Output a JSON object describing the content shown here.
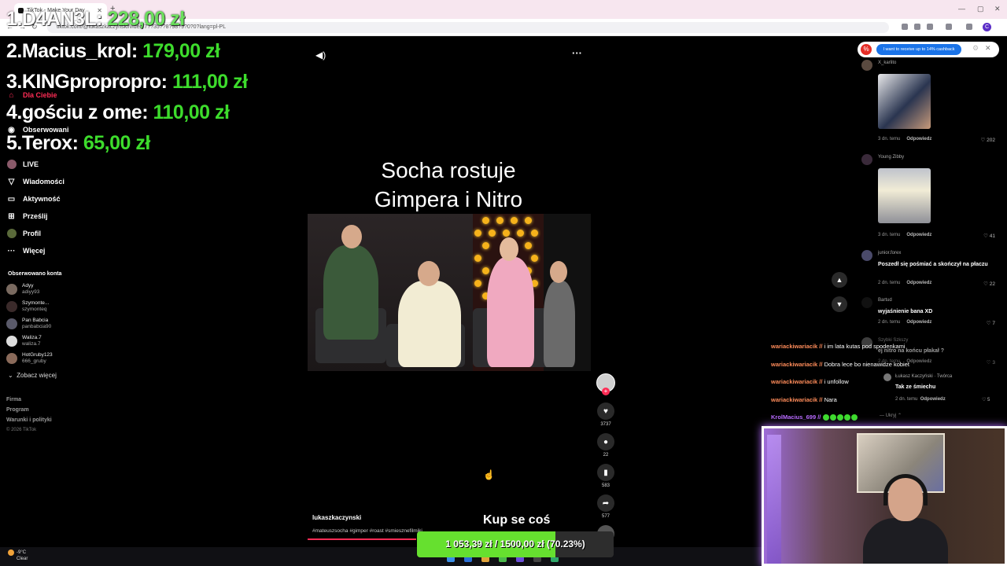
{
  "browser": {
    "tab_title": "TikTok - Make Your Day",
    "url": "tiktok.com/@lukaszkaczynski/video/7??35??8?98?9?0?0?lang=pl-PL",
    "profile_initial": "C"
  },
  "leaderboard": [
    {
      "rank_name": "1.D4AN3L:",
      "amount": "228,00 zł"
    },
    {
      "rank_name": "2.Macius_krol:",
      "amount": "179,00 zł"
    },
    {
      "rank_name": "3.KINGpropropro:",
      "amount": "111,00 zł"
    },
    {
      "rank_name": "4.gościu z ome:",
      "amount": "110,00 zł"
    },
    {
      "rank_name": "5.Terox:",
      "amount": "65,00 zł"
    }
  ],
  "sidebar": {
    "items": [
      {
        "label": "Dla Ciebie",
        "icon": "home-icon"
      },
      {
        "label": "Obserwowani",
        "icon": "following-icon"
      },
      {
        "label": "LIVE",
        "icon": "live-icon"
      },
      {
        "label": "Wiadomości",
        "icon": "messages-icon"
      },
      {
        "label": "Aktywność",
        "icon": "activity-icon"
      },
      {
        "label": "Prześlij",
        "icon": "upload-icon"
      },
      {
        "label": "Profil",
        "icon": "profile-icon"
      },
      {
        "label": "Więcej",
        "icon": "more-icon"
      }
    ],
    "followed_heading": "Obserwowano konta",
    "accounts": [
      {
        "name": "Adyy",
        "handle": "adiyy93"
      },
      {
        "name": "Szymonte...",
        "handle": "szymonteq"
      },
      {
        "name": "Pan Babcia",
        "handle": "panbabcia90"
      },
      {
        "name": "Waliza.7",
        "handle": "waliza.7"
      },
      {
        "name": "HotGruby123",
        "handle": "666_gruby"
      }
    ],
    "see_more": "Zobacz więcej",
    "footer_links": [
      "Firma",
      "Program",
      "Warunki i polityki"
    ],
    "copyright": "© 2026 TikTok"
  },
  "video": {
    "title_line1": "Socha rostuje",
    "title_line2": "Gimpera i Nitro",
    "author": "lukaszkaczynski",
    "hashtags": "#mateuszsocha #gimper #roast #smiesznefilmiki",
    "progress": 0.38
  },
  "actions": {
    "likes": "3737",
    "comments": "22",
    "saves": "583",
    "shares": "577"
  },
  "donation_goal": {
    "message": "Kup se coś",
    "text": "1 053,39 zł / 1500,00 zł (70.23%)",
    "fraction": 0.7023
  },
  "cashback_banner": {
    "text": "I want to receive up to 14% cashback"
  },
  "comments": [
    {
      "user": "X_karlito",
      "text": "",
      "time": "3 dn. temu",
      "reply": "Odpowiedz",
      "likes": "202"
    },
    {
      "user": "Young Zibby",
      "text": "",
      "time": "3 dn. temu",
      "reply": "Odpowiedz",
      "likes": "41"
    },
    {
      "user": "junior.forex",
      "text": "Poszedł się pośmiać a skończył na płaczu",
      "time": "2 dn. temu",
      "reply": "Odpowiedz",
      "likes": "22"
    },
    {
      "user": "Bartud",
      "text": "wyjaśnienie bana XD",
      "time": "2 dn. temu",
      "reply": "Odpowiedz",
      "likes": "7"
    },
    {
      "user": "Szybki Szkszy",
      "text": "ej nitro na końcu płakał ?",
      "time": "2 dn. temu",
      "reply": "Odpowiedz",
      "likes": "3"
    }
  ],
  "reply": {
    "user": "Łukasz Kaczyński · Twórca",
    "text": "Tak ze śmiechu",
    "time": "2 dn. temu",
    "reply": "Odpowiedz",
    "likes": "5",
    "hide": "— Ukryj ⌃"
  },
  "chat": [
    {
      "user": "wariackiwariacik //",
      "msg": "i im lata kutas pod spodenkami"
    },
    {
      "user": "wariackiwariacik //",
      "msg": "Dobra lece bo nienawidze kobiet"
    },
    {
      "user": "wariackiwariacik //",
      "msg": "i unfollow"
    },
    {
      "user": "wariackiwariacik //",
      "msg": "Nara"
    },
    {
      "user": "KrolMacius_699 //",
      "msg": ""
    }
  ],
  "taskbar": {
    "temp": "-9°C",
    "condition": "Clear"
  },
  "colors": {
    "tiktok_red": "#fe2c55",
    "goal_green": "#66e02f",
    "leader_green": "#3ddc2c"
  }
}
